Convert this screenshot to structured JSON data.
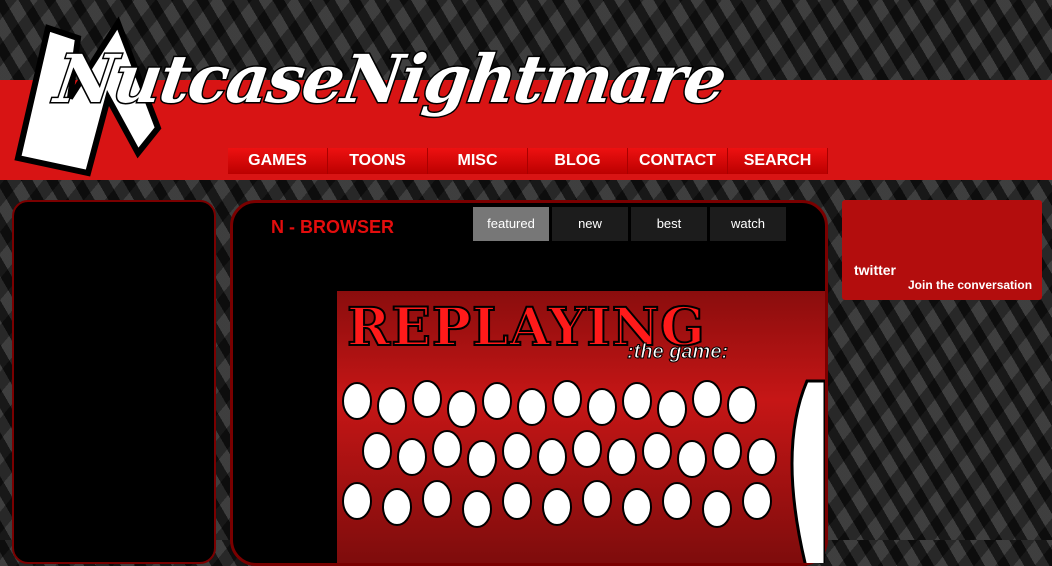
{
  "site": {
    "logo_text": "NutcaseNightmare"
  },
  "nav": {
    "items": [
      "GAMES",
      "TOONS",
      "MISC",
      "BLOG",
      "CONTACT",
      "SEARCH"
    ]
  },
  "browser": {
    "title": "N - BROWSER",
    "tabs": [
      "featured",
      "new",
      "best",
      "watch"
    ],
    "active_tab": "featured",
    "preview": {
      "title": "REPLAYING",
      "subtitle": ":the game:"
    }
  },
  "twitter": {
    "logo": "twitter",
    "tagline": "Join the conversation"
  },
  "colors": {
    "accent_red": "#d81414",
    "dark_red": "#7a0000"
  }
}
